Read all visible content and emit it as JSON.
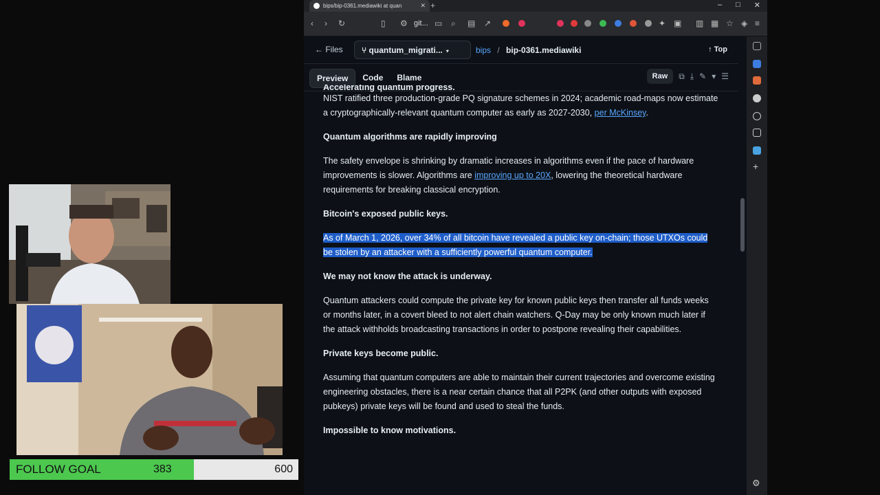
{
  "goal": {
    "label": "FOLLOW GOAL",
    "current": "383",
    "target": "600",
    "progress": 0.638
  },
  "browser": {
    "tab_title": "bips/bip-0361.mediawiki at quan",
    "url": "git...",
    "new_tab": "+",
    "window_controls": [
      "–",
      "□",
      "✕"
    ]
  },
  "github": {
    "files_label": "Files",
    "branch": "quantum_migrati...",
    "crumb_repo": "bips",
    "crumb_sep": "/",
    "crumb_file": "bip-0361.mediawiki",
    "top_label": "Top",
    "tabs": [
      "Preview",
      "Code",
      "Blame"
    ],
    "raw_label": "Raw"
  },
  "article": {
    "cut_heading": "Accelerating quantum progress.",
    "p1": "NIST ratified three production-grade PQ signature schemes in 2024; academic road-maps now estimate a cryptographically-relevant quantum computer as early as 2027-2030, ",
    "p1_link": "per McKinsey",
    "p1_end": ".",
    "h2": "Quantum algorithms are rapidly improving",
    "p2a": "The safety envelope is shrinking by dramatic increases in algorithms even if the pace of hardware improvements is slower. Algorithms are ",
    "p2_link": "improving up to 20X",
    "p2b": ", lowering the theoretical hardware requirements for breaking classical encryption.",
    "h3": "Bitcoin's exposed public keys.",
    "p3": "As of March 1, 2026, over 34% of all bitcoin have revealed a public key on-chain; those UTXOs could be stolen by an attacker with a sufficiently powerful quantum computer.",
    "h4": "We may not know the attack is underway.",
    "p4": "Quantum attackers could compute the private key for known public keys then transfer all funds weeks or months later, in a covert bleed to not alert chain watchers. Q-Day may be only known much later if the attack withholds broadcasting transactions in order to postpone revealing their capabilities.",
    "h5": "Private keys become public.",
    "p5": "Assuming that quantum computers are able to maintain their current trajectories and overcome existing engineering obstacles, there is a near certain chance that all P2PK (and other outputs with exposed pubkeys) private keys will be found and used to steal the funds.",
    "h6": "Impossible to know motivations."
  }
}
